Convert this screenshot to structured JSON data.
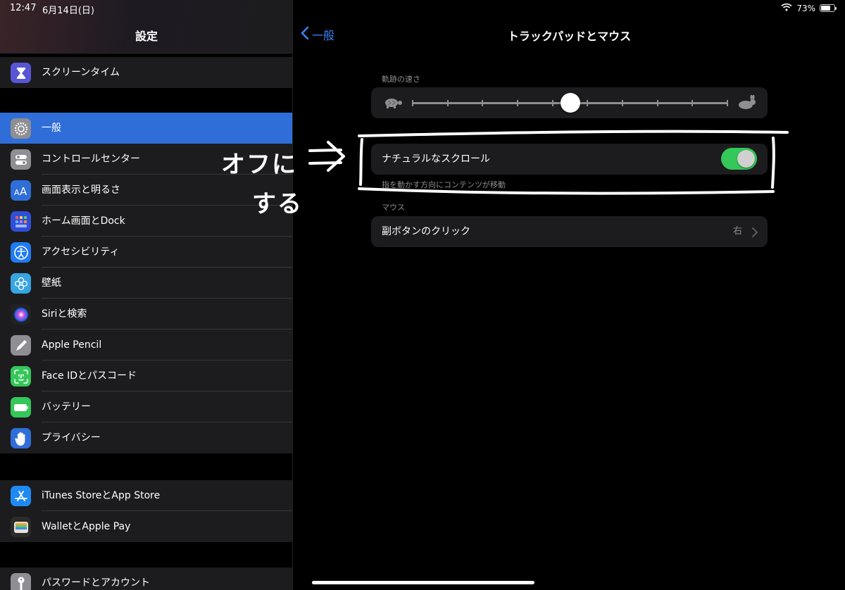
{
  "status_bar": {
    "time": "12:47",
    "date": "6月14日(日)",
    "battery_percent": "73%",
    "battery_level": 0.73
  },
  "sidebar": {
    "title": "設定",
    "groups": [
      {
        "items": [
          {
            "label": "スクリーンタイム",
            "icon": "hourglass-icon",
            "color": "#5856d6"
          }
        ]
      },
      {
        "items": [
          {
            "label": "一般",
            "icon": "gear-icon",
            "color": "#8e8e93",
            "selected": true
          },
          {
            "label": "コントロールセンター",
            "icon": "toggles-icon",
            "color": "#8e8e93"
          },
          {
            "label": "画面表示と明るさ",
            "icon": "text-size-icon",
            "color": "#2f6ed8"
          },
          {
            "label": "ホーム画面とDock",
            "icon": "app-grid-icon",
            "color": "#2f4fd8"
          },
          {
            "label": "アクセシビリティ",
            "icon": "accessibility-icon",
            "color": "#1f7bf2"
          },
          {
            "label": "壁紙",
            "icon": "flower-icon",
            "color": "#36a5e0"
          },
          {
            "label": "Siriと検索",
            "icon": "siri-icon",
            "color": "#222222"
          },
          {
            "label": "Apple Pencil",
            "icon": "pencil-icon",
            "color": "#8e8e93"
          },
          {
            "label": "Face IDとパスコード",
            "icon": "face-id-icon",
            "color": "#34c759"
          },
          {
            "label": "バッテリー",
            "icon": "battery-icon",
            "color": "#34c759"
          },
          {
            "label": "プライバシー",
            "icon": "hand-icon",
            "color": "#2f6ed8"
          }
        ]
      },
      {
        "items": [
          {
            "label": "iTunes StoreとApp Store",
            "icon": "app-store-icon",
            "color": "#1f8af2"
          },
          {
            "label": "WalletとApple Pay",
            "icon": "wallet-icon",
            "color": "#2b2b2b"
          }
        ]
      },
      {
        "items": [
          {
            "label": "パスワードとアカウント",
            "icon": "key-icon",
            "color": "#8e8e93"
          }
        ]
      }
    ]
  },
  "detail": {
    "back_label": "一般",
    "title": "トラックパッドとマウス",
    "tracking_speed": {
      "label": "軌跡の速さ",
      "ticks": 10,
      "value_fraction": 0.5
    },
    "natural_scroll": {
      "label": "ナチュラルなスクロール",
      "enabled": true,
      "footnote": "指を動かす方向にコンテンツが移動"
    },
    "mouse_section": {
      "label": "マウス"
    },
    "secondary_click": {
      "label": "副ボタンのクリック",
      "value": "右"
    }
  },
  "annotation": {
    "arrow": "⇒",
    "line1": "オフに",
    "line2": "する",
    "color": "#ffffff"
  }
}
